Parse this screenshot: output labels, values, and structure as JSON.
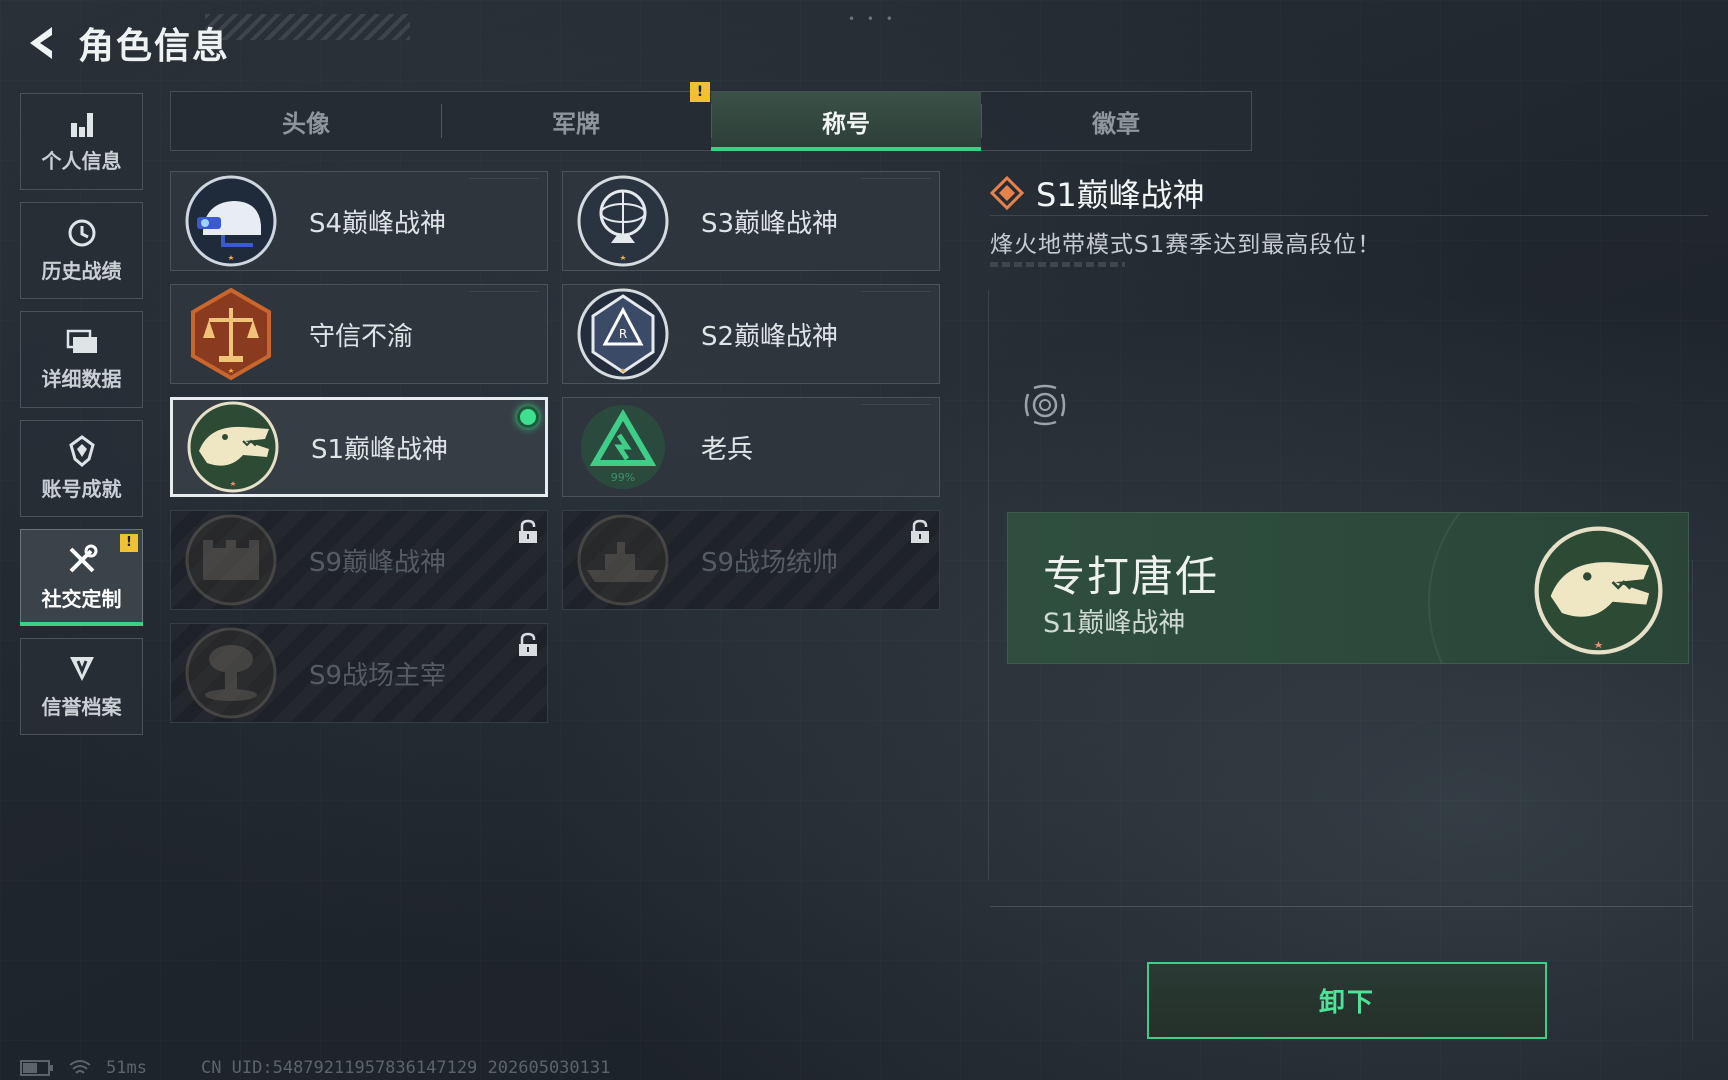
{
  "header": {
    "title": "角色信息"
  },
  "sidebar": {
    "items": [
      {
        "label": "个人信息",
        "icon": "bar-chart-icon"
      },
      {
        "label": "历史战绩",
        "icon": "history-icon"
      },
      {
        "label": "详细数据",
        "icon": "folder-icon"
      },
      {
        "label": "账号成就",
        "icon": "achievement-icon"
      },
      {
        "label": "社交定制",
        "icon": "tools-icon",
        "badge": "!"
      },
      {
        "label": "信誉档案",
        "icon": "credit-icon"
      }
    ],
    "active": "社交定制"
  },
  "tabs": {
    "items": [
      "头像",
      "军牌",
      "称号",
      "徽章"
    ],
    "active": "称号",
    "badge": "!"
  },
  "titles": [
    {
      "label": "S4巅峰战神",
      "state": "unlocked",
      "emblem": "s4-helmet-emblem"
    },
    {
      "label": "S3巅峰战神",
      "state": "unlocked",
      "emblem": "s3-globe-emblem"
    },
    {
      "label": "守信不渝",
      "state": "unlocked",
      "emblem": "scales-emblem"
    },
    {
      "label": "S2巅峰战神",
      "state": "unlocked",
      "emblem": "s2-badge-emblem"
    },
    {
      "label": "S1巅峰战神",
      "state": "selected",
      "emblem": "crocodile-emblem"
    },
    {
      "label": "老兵",
      "state": "unlocked",
      "emblem": "veteran-emblem",
      "emblem_text": "99%"
    },
    {
      "label": "S9巅峰战神",
      "state": "locked",
      "emblem": "fortress-emblem"
    },
    {
      "label": "S9战场统帅",
      "state": "locked",
      "emblem": "warship-emblem"
    },
    {
      "label": "S9战场主宰",
      "state": "locked",
      "emblem": "mushroom-cloud-emblem"
    }
  ],
  "detail": {
    "title": "S1巅峰战神",
    "description": "烽火地带模式S1赛季达到最高段位！"
  },
  "preview": {
    "player_name": "专打唐任",
    "title": "S1巅峰战神"
  },
  "actions": {
    "unequip_label": "卸下"
  },
  "footer": {
    "ping": "51ms",
    "uid": "CN UID:54879211957836147129 202605030131"
  },
  "colors": {
    "accent": "#3fce88",
    "badge": "#f0c233",
    "card": "#30363e"
  }
}
